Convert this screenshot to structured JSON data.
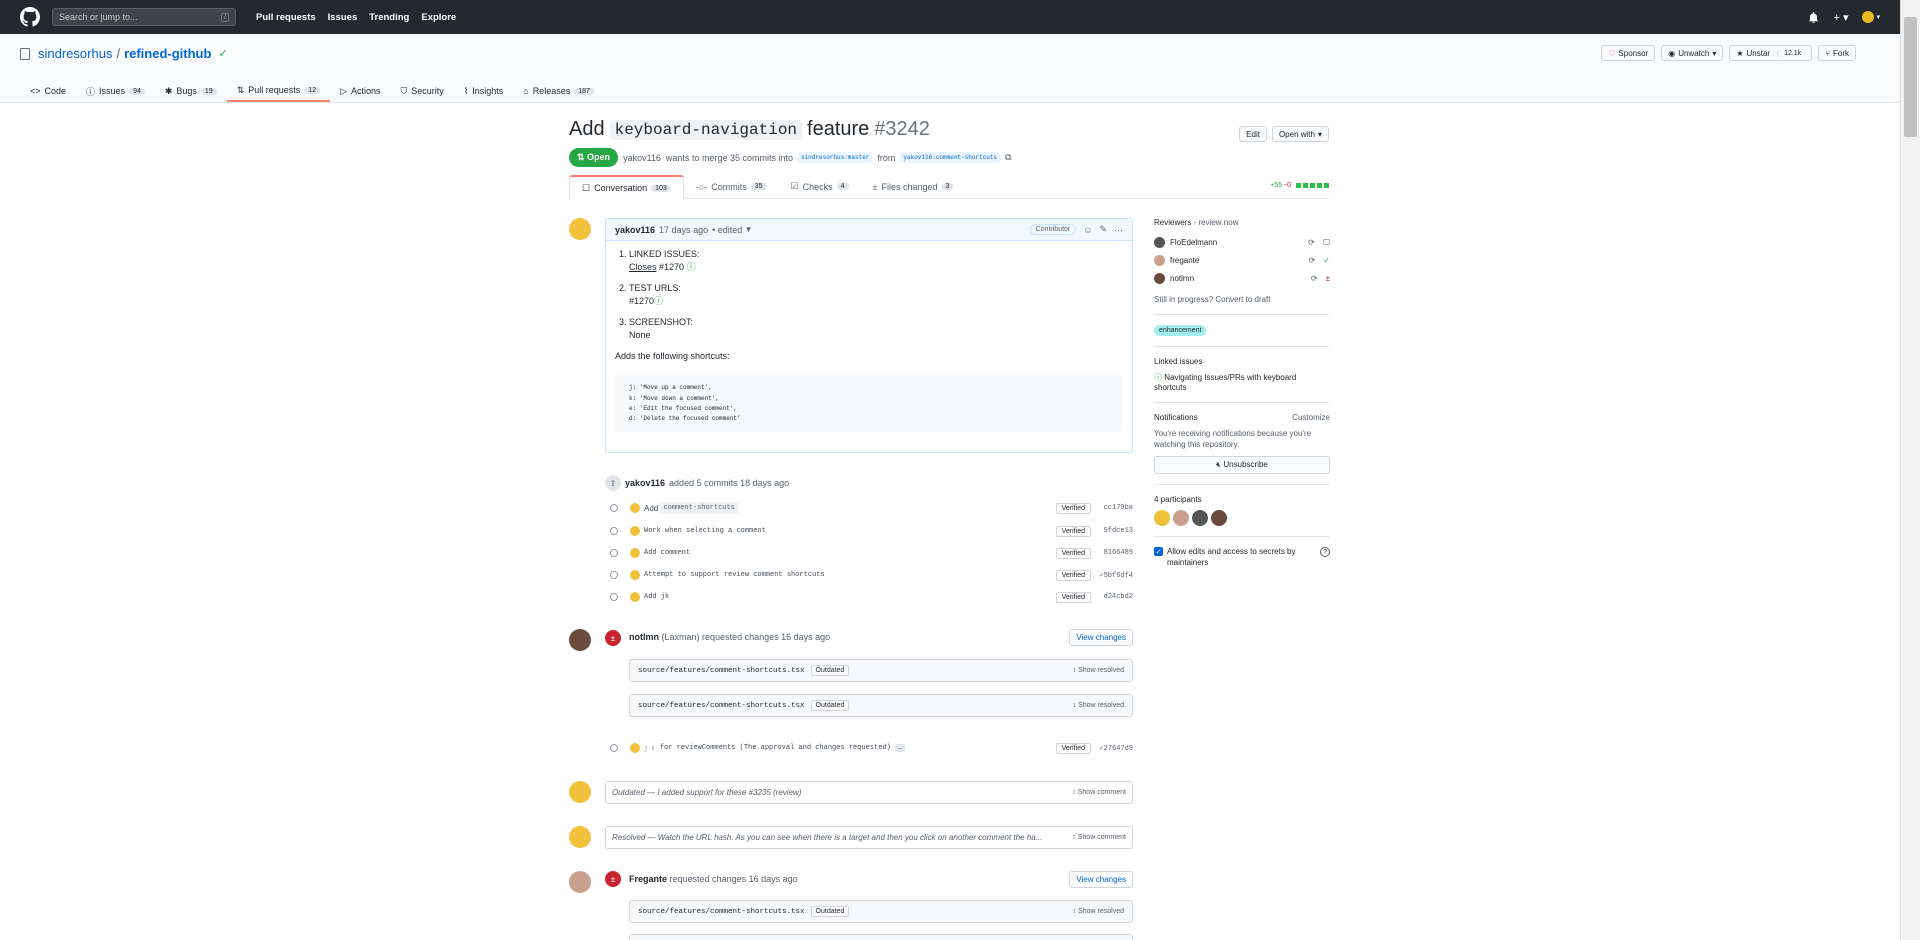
{
  "topbar": {
    "search_placeholder": "Search or jump to...",
    "search_key": "/",
    "nav": [
      "Pull requests",
      "Issues",
      "Trending",
      "Explore"
    ]
  },
  "repo": {
    "owner": "sindresorhus",
    "separator": "/",
    "name": "refined-github",
    "actions": {
      "sponsor": "Sponsor",
      "unwatch": "Unwatch",
      "unstar": "Unstar",
      "star_count": "12.1k",
      "fork": "Fork"
    },
    "tabs": [
      {
        "label": "Code",
        "count": ""
      },
      {
        "label": "Issues",
        "count": "94"
      },
      {
        "label": "Bugs",
        "count": "19"
      },
      {
        "label": "Pull requests",
        "count": "12"
      },
      {
        "label": "Actions",
        "count": ""
      },
      {
        "label": "Security",
        "count": ""
      },
      {
        "label": "Insights",
        "count": ""
      },
      {
        "label": "Releases",
        "count": "187"
      }
    ]
  },
  "pr": {
    "title_pre": "Add",
    "title_code": "keyboard-navigation",
    "title_post": "feature",
    "number": "#3242",
    "edit": "Edit",
    "open_with": "Open with",
    "state": "Open",
    "meta_user": "yakov116",
    "meta_text": "wants to merge 35 commits into",
    "base_branch": "sindresorhus:master",
    "from": "from",
    "head_branch": "yakov116:comment-shortcuts",
    "tabs": [
      {
        "label": "Conversation",
        "count": "103"
      },
      {
        "label": "Commits",
        "count": "35"
      },
      {
        "label": "Checks",
        "count": "4"
      },
      {
        "label": "Files changed",
        "count": "3"
      }
    ],
    "diff_add": "+55",
    "diff_del": "−0"
  },
  "comment": {
    "author": "yakov116",
    "time": "17 days ago",
    "edited": "• edited",
    "role": "Contributor",
    "items": [
      {
        "head": "LINKED ISSUES:",
        "line_a": "Closes",
        "line_b": "#1270"
      },
      {
        "head": "TEST URLS:",
        "line_a": "",
        "line_b": "#1270"
      },
      {
        "head": "SCREENSHOT:",
        "line_a": "None",
        "line_b": ""
      }
    ],
    "para": "Adds the following shortcuts:",
    "code": [
      "j: 'Move up a comment',",
      "k: 'Move down a comment',",
      "e: 'Edit the focused comment',",
      "d: 'Delete the focused comment'"
    ]
  },
  "commits_event": {
    "user": "yakov116",
    "text": "added 5 commits 18 days ago"
  },
  "commits": [
    {
      "pre": "Add",
      "code": "comment-shortcuts",
      "msg": "",
      "verified": "Verified",
      "sha": "cc179ba"
    },
    {
      "pre": "",
      "code": "",
      "msg": "Work when selecting a comment",
      "verified": "Verified",
      "sha": "9fdce13"
    },
    {
      "pre": "",
      "code": "",
      "msg": "Add comment",
      "verified": "Verified",
      "sha": "8166489"
    },
    {
      "pre": "",
      "code": "",
      "msg": "Attempt to support review comment shortcuts",
      "verified": "Verified",
      "sha": "✓5bf6df4"
    },
    {
      "pre": "",
      "code": "",
      "msg": "Add jk",
      "verified": "Verified",
      "sha": "d24cbd2"
    }
  ],
  "review1": {
    "user": "notlmn",
    "realname": "(Laxman)",
    "text": "requested changes 16 days ago",
    "button": "View changes",
    "files": [
      {
        "path": "source/features/comment-shortcuts.tsx",
        "badge": "Outdated",
        "action": "Show resolved"
      },
      {
        "path": "source/features/comment-shortcuts.tsx",
        "badge": "Outdated",
        "action": "Show resolved"
      }
    ]
  },
  "commit_late": {
    "keys": "j k",
    "msg": "for reviewComments (The approval and changes requested)",
    "more": "…",
    "verified": "Verified",
    "sha": "✓27647d9"
  },
  "hidden1": {
    "text": "Outdated — I added support for these #3235 (review)",
    "action": "Show comment"
  },
  "hidden2": {
    "text": "Resolved — Watch the URL hash. As you can see when there is a target and then you click on another comment the ha...",
    "action": "Show comment"
  },
  "review2": {
    "user": "Fregante",
    "text": "requested changes 16 days ago",
    "button": "View changes",
    "file": {
      "path": "source/features/comment-shortcuts.tsx",
      "badge": "Outdated",
      "action": "Show resolved"
    }
  },
  "sidebar": {
    "reviewers_title": "Reviewers",
    "reviewers_sub": "- review now",
    "reviewers": [
      {
        "name": "FloEdelmann",
        "status": "comment"
      },
      {
        "name": "fregante",
        "status": "approved"
      },
      {
        "name": "notlmn",
        "status": "changes"
      }
    ],
    "draft": "Still in progress? Convert to draft",
    "label": "enhancement",
    "linked_title": "Linked issues",
    "linked_issue": "Navigating Issues/PRs with keyboard shortcuts",
    "notif_title": "Notifications",
    "customize": "Customize",
    "notif_text": "You're receiving notifications because you're watching this repository.",
    "unsubscribe": "Unsubscribe",
    "participants": "4 participants",
    "allow": "Allow edits and access to secrets by maintainers"
  },
  "colors": {
    "open": "#28a745",
    "link": "#0366d6",
    "tab_accent": "#f9826c",
    "changes": "#cb2431"
  }
}
